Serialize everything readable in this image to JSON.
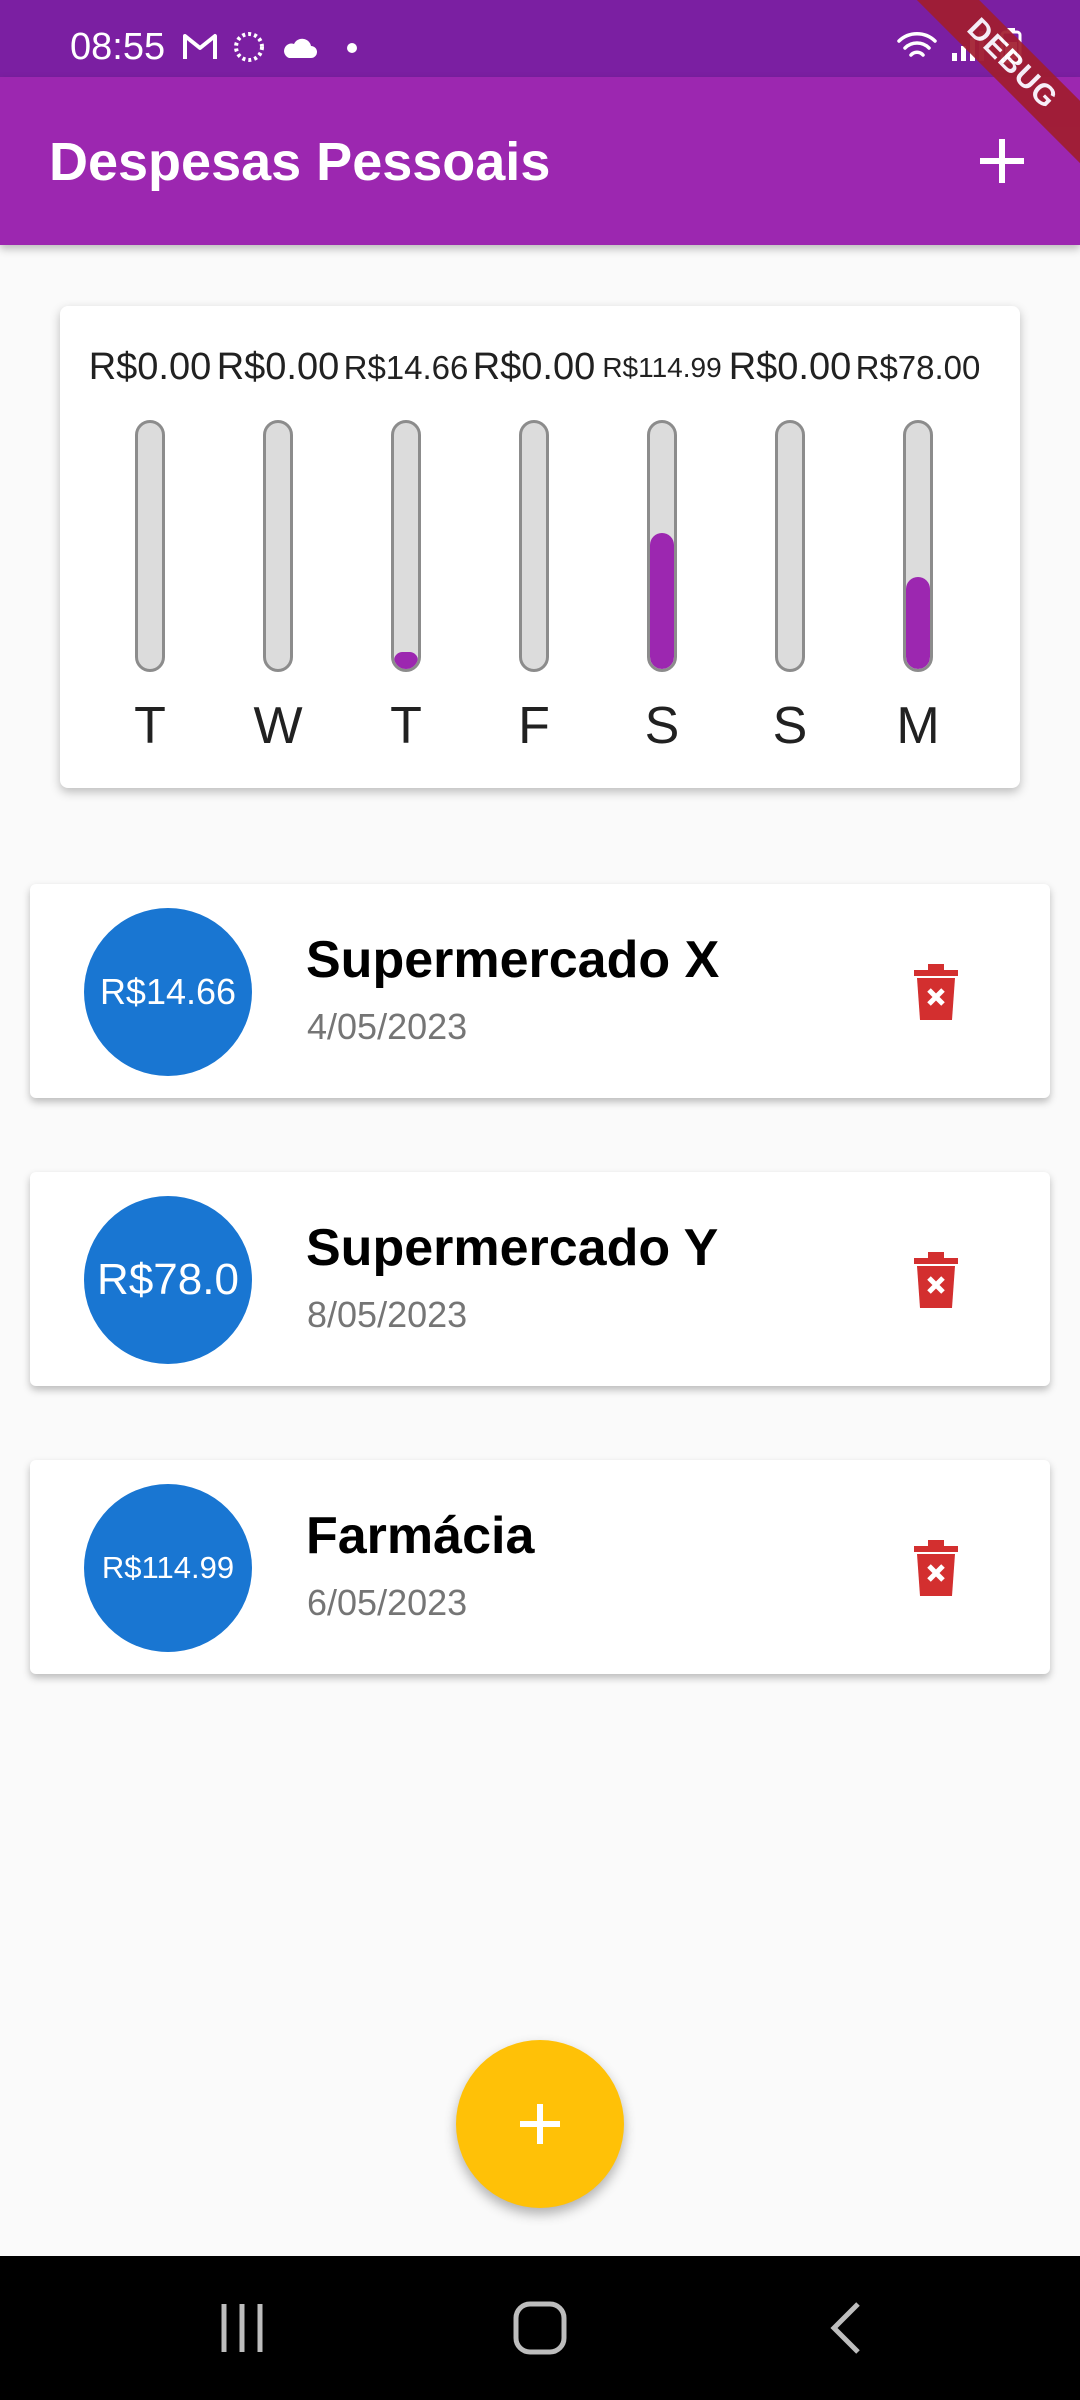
{
  "status_bar": {
    "time": "08:55",
    "left_icons": [
      "gmail-icon",
      "sync-icon",
      "cloud-icon",
      "dot-icon"
    ],
    "right_icons": [
      "wifi-icon",
      "signal-icon",
      "battery-icon"
    ]
  },
  "debug_banner": "DEBUG",
  "app_bar": {
    "title": "Despesas Pessoais",
    "add_icon": "plus-icon"
  },
  "chart": {
    "accent": "#9c27b0",
    "days": [
      {
        "label": "R$0.00",
        "day": "T",
        "fraction": 0.0
      },
      {
        "label": "R$0.00",
        "day": "W",
        "fraction": 0.0
      },
      {
        "label": "R$14.66",
        "day": "T",
        "fraction": 0.0706
      },
      {
        "label": "R$0.00",
        "day": "F",
        "fraction": 0.0
      },
      {
        "label": "R$114.99",
        "day": "S",
        "fraction": 0.5538
      },
      {
        "label": "R$0.00",
        "day": "S",
        "fraction": 0.0
      },
      {
        "label": "R$78.00",
        "day": "M",
        "fraction": 0.3756
      }
    ]
  },
  "transactions": [
    {
      "amount": "R$14.66",
      "title": "Supermercado X",
      "date": "4/05/2023"
    },
    {
      "amount": "R$78.0",
      "title": "Supermercado Y",
      "date": "8/05/2023"
    },
    {
      "amount": "R$114.99",
      "title": "Farmácia",
      "date": "6/05/2023"
    }
  ],
  "colors": {
    "status_bar": "#7b1fa2",
    "app_bar": "#9c27b0",
    "avatar": "#1976d2",
    "delete": "#d32f2f",
    "fab": "#ffc107"
  },
  "fab": {
    "icon": "plus-icon"
  },
  "nav_bar": {
    "icons": [
      "recent-apps-icon",
      "home-icon",
      "back-icon"
    ]
  }
}
